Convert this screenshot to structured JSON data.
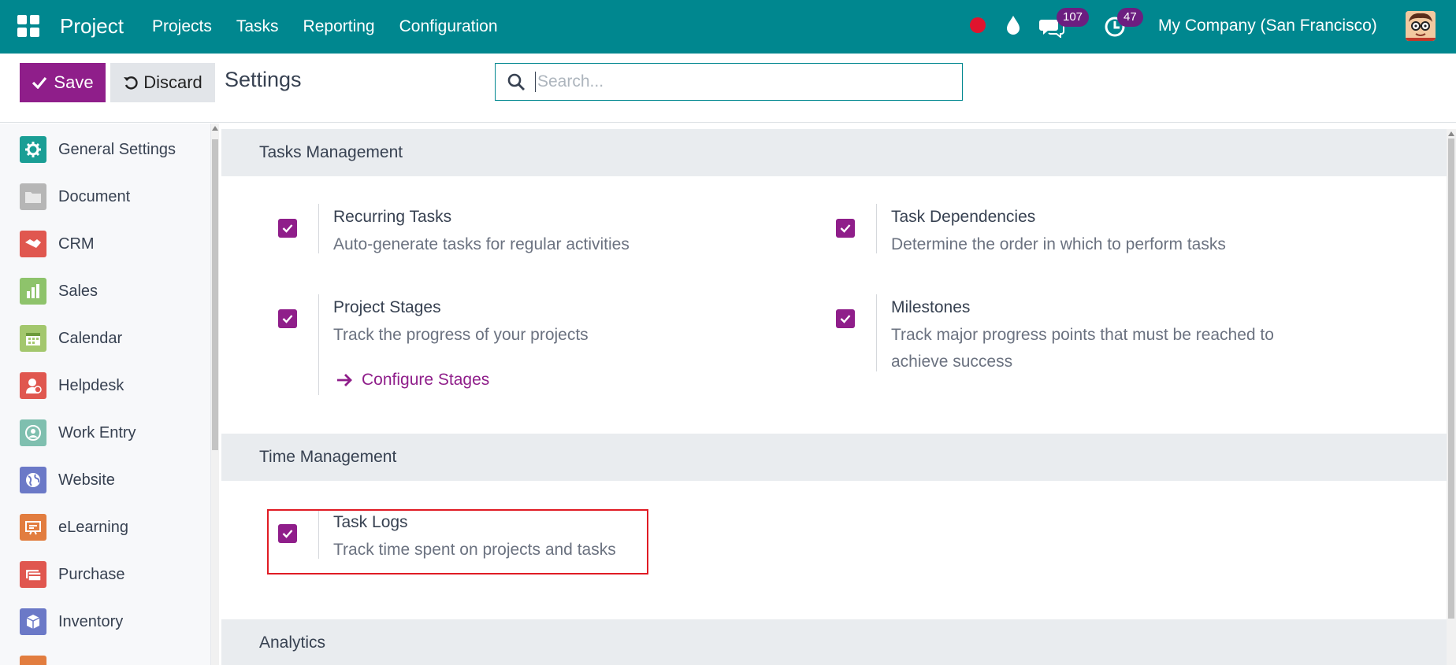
{
  "navbar": {
    "brand": "Project",
    "menu": [
      "Projects",
      "Tasks",
      "Reporting",
      "Configuration"
    ],
    "message_count": "107",
    "activity_count": "47",
    "company": "My Company (San Francisco)"
  },
  "control_panel": {
    "save_label": "Save",
    "discard_label": "Discard",
    "title": "Settings",
    "search_placeholder": "Search..."
  },
  "sidebar": {
    "items": [
      {
        "label": "General Settings",
        "icon": "gear-icon",
        "color": "#1a9e95"
      },
      {
        "label": "Document",
        "icon": "folder-icon",
        "color": "#b6b6b6"
      },
      {
        "label": "CRM",
        "icon": "handshake-icon",
        "color": "#e0574f"
      },
      {
        "label": "Sales",
        "icon": "chart-icon",
        "color": "#8ec36b"
      },
      {
        "label": "Calendar",
        "icon": "calendar-icon",
        "color": "#a3c76d"
      },
      {
        "label": "Helpdesk",
        "icon": "helpdesk-icon",
        "color": "#e0574f"
      },
      {
        "label": "Work Entry",
        "icon": "work-entry-icon",
        "color": "#7fbfaf"
      },
      {
        "label": "Website",
        "icon": "globe-icon",
        "color": "#6b79c7"
      },
      {
        "label": "eLearning",
        "icon": "elearning-icon",
        "color": "#e27d3f"
      },
      {
        "label": "Purchase",
        "icon": "card-icon",
        "color": "#e0574f"
      },
      {
        "label": "Inventory",
        "icon": "box-icon",
        "color": "#6b79c7"
      },
      {
        "label": "",
        "icon": "partial-icon",
        "color": "#e27d3f"
      }
    ]
  },
  "sections": {
    "tasks_management": {
      "title": "Tasks Management",
      "settings": [
        {
          "title": "Recurring Tasks",
          "desc": "Auto-generate tasks for regular activities",
          "checked": true
        },
        {
          "title": "Task Dependencies",
          "desc": "Determine the order in which to perform tasks",
          "checked": true
        },
        {
          "title": "Project Stages",
          "desc": "Track the progress of your projects",
          "link": "Configure Stages",
          "checked": true
        },
        {
          "title": "Milestones",
          "desc": "Track major progress points that must be reached to achieve success",
          "checked": true
        }
      ]
    },
    "time_management": {
      "title": "Time Management",
      "settings": [
        {
          "title": "Task Logs",
          "desc": "Track time spent on projects and tasks",
          "checked": true
        }
      ]
    },
    "analytics": {
      "title": "Analytics"
    }
  },
  "colors": {
    "navbar": "#00878f",
    "primary": "#8f1e8a",
    "highlight": "#e01b24",
    "recording": "#e0142e"
  }
}
